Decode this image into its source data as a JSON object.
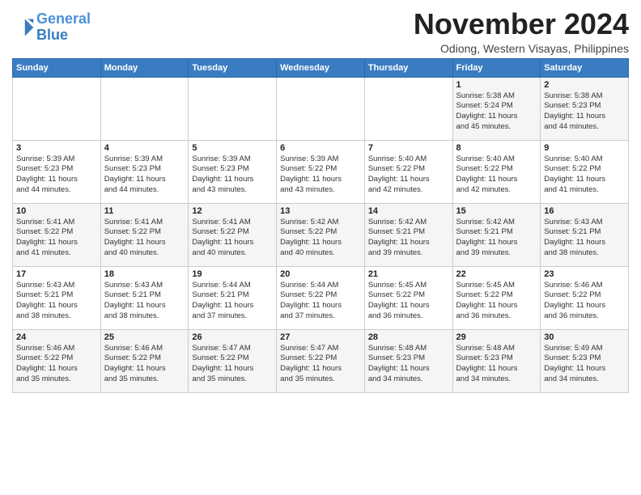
{
  "header": {
    "logo_line1": "General",
    "logo_line2": "Blue",
    "month": "November 2024",
    "location": "Odiong, Western Visayas, Philippines"
  },
  "days_of_week": [
    "Sunday",
    "Monday",
    "Tuesday",
    "Wednesday",
    "Thursday",
    "Friday",
    "Saturday"
  ],
  "weeks": [
    [
      {
        "day": "",
        "info": ""
      },
      {
        "day": "",
        "info": ""
      },
      {
        "day": "",
        "info": ""
      },
      {
        "day": "",
        "info": ""
      },
      {
        "day": "",
        "info": ""
      },
      {
        "day": "1",
        "info": "Sunrise: 5:38 AM\nSunset: 5:24 PM\nDaylight: 11 hours\nand 45 minutes."
      },
      {
        "day": "2",
        "info": "Sunrise: 5:38 AM\nSunset: 5:23 PM\nDaylight: 11 hours\nand 44 minutes."
      }
    ],
    [
      {
        "day": "3",
        "info": "Sunrise: 5:39 AM\nSunset: 5:23 PM\nDaylight: 11 hours\nand 44 minutes."
      },
      {
        "day": "4",
        "info": "Sunrise: 5:39 AM\nSunset: 5:23 PM\nDaylight: 11 hours\nand 44 minutes."
      },
      {
        "day": "5",
        "info": "Sunrise: 5:39 AM\nSunset: 5:23 PM\nDaylight: 11 hours\nand 43 minutes."
      },
      {
        "day": "6",
        "info": "Sunrise: 5:39 AM\nSunset: 5:22 PM\nDaylight: 11 hours\nand 43 minutes."
      },
      {
        "day": "7",
        "info": "Sunrise: 5:40 AM\nSunset: 5:22 PM\nDaylight: 11 hours\nand 42 minutes."
      },
      {
        "day": "8",
        "info": "Sunrise: 5:40 AM\nSunset: 5:22 PM\nDaylight: 11 hours\nand 42 minutes."
      },
      {
        "day": "9",
        "info": "Sunrise: 5:40 AM\nSunset: 5:22 PM\nDaylight: 11 hours\nand 41 minutes."
      }
    ],
    [
      {
        "day": "10",
        "info": "Sunrise: 5:41 AM\nSunset: 5:22 PM\nDaylight: 11 hours\nand 41 minutes."
      },
      {
        "day": "11",
        "info": "Sunrise: 5:41 AM\nSunset: 5:22 PM\nDaylight: 11 hours\nand 40 minutes."
      },
      {
        "day": "12",
        "info": "Sunrise: 5:41 AM\nSunset: 5:22 PM\nDaylight: 11 hours\nand 40 minutes."
      },
      {
        "day": "13",
        "info": "Sunrise: 5:42 AM\nSunset: 5:22 PM\nDaylight: 11 hours\nand 40 minutes."
      },
      {
        "day": "14",
        "info": "Sunrise: 5:42 AM\nSunset: 5:21 PM\nDaylight: 11 hours\nand 39 minutes."
      },
      {
        "day": "15",
        "info": "Sunrise: 5:42 AM\nSunset: 5:21 PM\nDaylight: 11 hours\nand 39 minutes."
      },
      {
        "day": "16",
        "info": "Sunrise: 5:43 AM\nSunset: 5:21 PM\nDaylight: 11 hours\nand 38 minutes."
      }
    ],
    [
      {
        "day": "17",
        "info": "Sunrise: 5:43 AM\nSunset: 5:21 PM\nDaylight: 11 hours\nand 38 minutes."
      },
      {
        "day": "18",
        "info": "Sunrise: 5:43 AM\nSunset: 5:21 PM\nDaylight: 11 hours\nand 38 minutes."
      },
      {
        "day": "19",
        "info": "Sunrise: 5:44 AM\nSunset: 5:21 PM\nDaylight: 11 hours\nand 37 minutes."
      },
      {
        "day": "20",
        "info": "Sunrise: 5:44 AM\nSunset: 5:22 PM\nDaylight: 11 hours\nand 37 minutes."
      },
      {
        "day": "21",
        "info": "Sunrise: 5:45 AM\nSunset: 5:22 PM\nDaylight: 11 hours\nand 36 minutes."
      },
      {
        "day": "22",
        "info": "Sunrise: 5:45 AM\nSunset: 5:22 PM\nDaylight: 11 hours\nand 36 minutes."
      },
      {
        "day": "23",
        "info": "Sunrise: 5:46 AM\nSunset: 5:22 PM\nDaylight: 11 hours\nand 36 minutes."
      }
    ],
    [
      {
        "day": "24",
        "info": "Sunrise: 5:46 AM\nSunset: 5:22 PM\nDaylight: 11 hours\nand 35 minutes."
      },
      {
        "day": "25",
        "info": "Sunrise: 5:46 AM\nSunset: 5:22 PM\nDaylight: 11 hours\nand 35 minutes."
      },
      {
        "day": "26",
        "info": "Sunrise: 5:47 AM\nSunset: 5:22 PM\nDaylight: 11 hours\nand 35 minutes."
      },
      {
        "day": "27",
        "info": "Sunrise: 5:47 AM\nSunset: 5:22 PM\nDaylight: 11 hours\nand 35 minutes."
      },
      {
        "day": "28",
        "info": "Sunrise: 5:48 AM\nSunset: 5:23 PM\nDaylight: 11 hours\nand 34 minutes."
      },
      {
        "day": "29",
        "info": "Sunrise: 5:48 AM\nSunset: 5:23 PM\nDaylight: 11 hours\nand 34 minutes."
      },
      {
        "day": "30",
        "info": "Sunrise: 5:49 AM\nSunset: 5:23 PM\nDaylight: 11 hours\nand 34 minutes."
      }
    ]
  ]
}
